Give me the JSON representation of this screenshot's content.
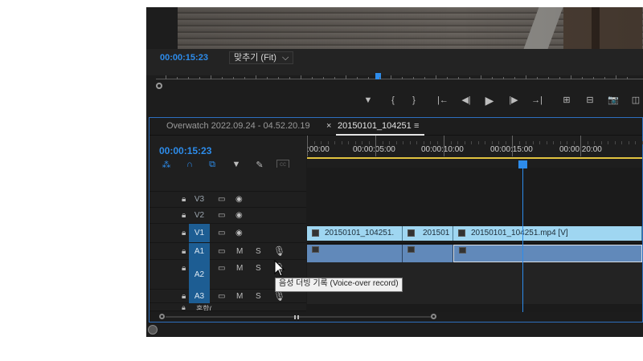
{
  "program_monitor": {
    "timecode": "00:00:15:23",
    "fit_label": "맞추기 (Fit)",
    "fit_arrow": "⌵",
    "controls": [
      "▼",
      "{",
      "}",
      "|←",
      "◀|",
      "▶",
      "|▶",
      "→|",
      "⊞",
      "⊟",
      "📷",
      "◫"
    ]
  },
  "timeline": {
    "tabs": [
      {
        "label": "Overwatch 2022.09.24 - 04.52.20.19"
      },
      {
        "label": "20150101_104251",
        "close": "×",
        "menu": "≡"
      }
    ],
    "timecode": "00:00:15:23",
    "ruler_labels": [
      ":00:00",
      "00:00:05:00",
      "00:00:10:00",
      "00:00:15:00",
      "00:00:20:00"
    ],
    "tracks": [
      {
        "name": "V3"
      },
      {
        "name": "V2"
      },
      {
        "name": "V1"
      },
      {
        "name": "A1",
        "m": "M",
        "s": "S"
      },
      {
        "name": "A2",
        "m": "M",
        "s": "S"
      },
      {
        "name": "A3",
        "m": "M",
        "s": "S"
      }
    ],
    "mix_label": "혼합(",
    "video_clips": [
      {
        "label": "20150101_104251."
      },
      {
        "label": "201501"
      },
      {
        "label": "20150101_104251.mp4 [V]"
      }
    ]
  },
  "tooltip": {
    "text": "음성 더빙 기록 (Voice-over record)"
  },
  "colors": {
    "accent": "#2d8ceb",
    "work_area": "#e2c33f",
    "video_clip": "#9fd6f1",
    "audio_clip": "#6189ba"
  }
}
